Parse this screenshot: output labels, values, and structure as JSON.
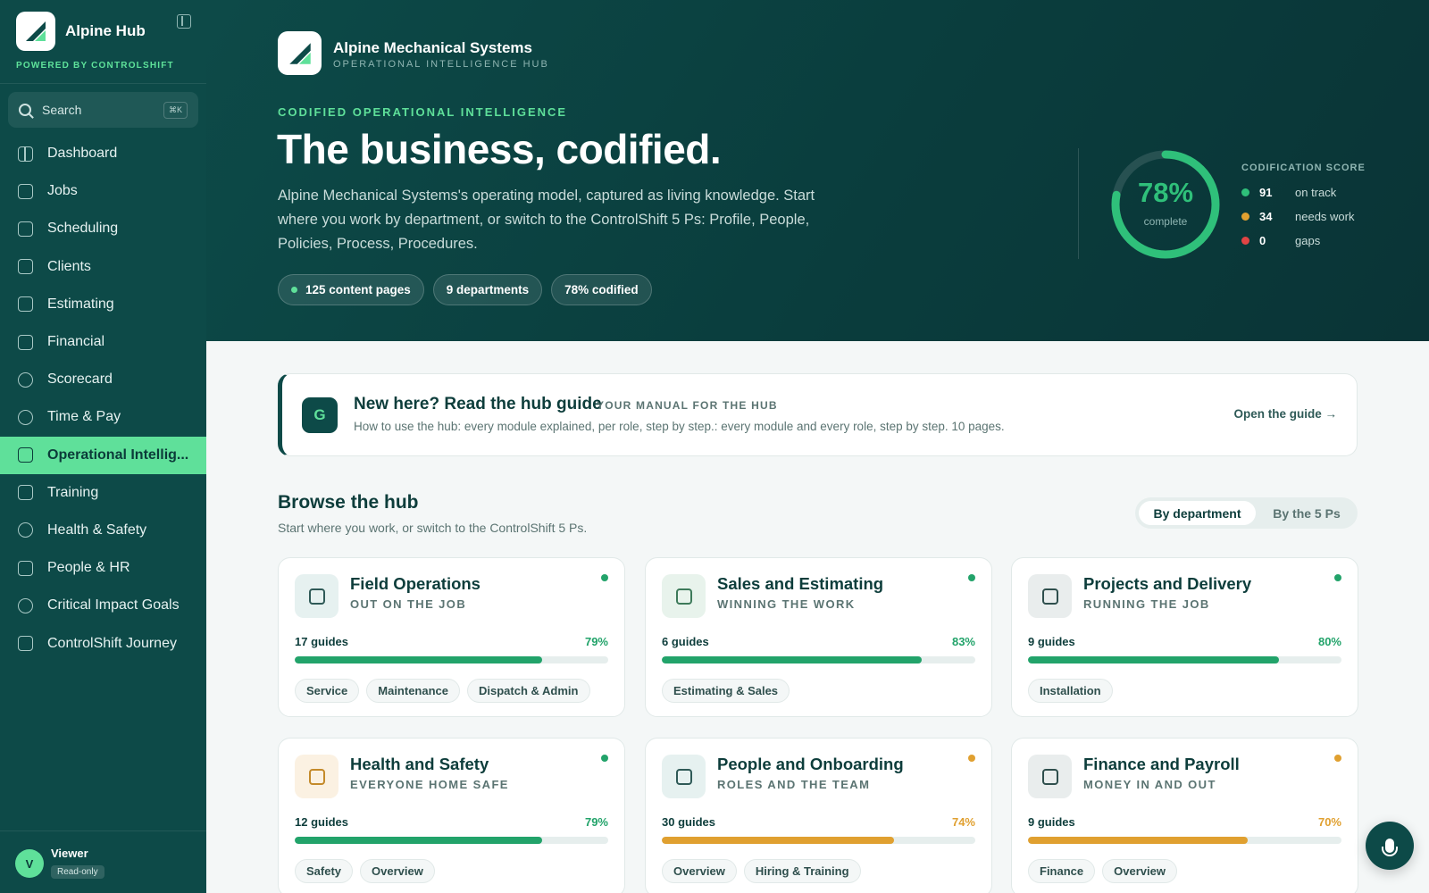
{
  "sidebar": {
    "brand": "Alpine Hub",
    "powered_by": "POWERED BY CONTROLSHIFT",
    "search_label": "Search",
    "search_shortcut": "⌘K",
    "items": [
      {
        "label": "Dashboard",
        "icon": "dashboard-icon"
      },
      {
        "label": "Jobs",
        "icon": "briefcase-icon"
      },
      {
        "label": "Scheduling",
        "icon": "calendar-icon"
      },
      {
        "label": "Clients",
        "icon": "clients-icon"
      },
      {
        "label": "Estimating",
        "icon": "calculator-icon"
      },
      {
        "label": "Financial",
        "icon": "credit-card-icon"
      },
      {
        "label": "Scorecard",
        "icon": "gauge-icon"
      },
      {
        "label": "Time & Pay",
        "icon": "clock-icon"
      },
      {
        "label": "Operational Intellig...",
        "icon": "book-icon"
      },
      {
        "label": "Training",
        "icon": "graduation-cap-icon"
      },
      {
        "label": "Health & Safety",
        "icon": "shield-icon"
      },
      {
        "label": "People & HR",
        "icon": "people-icon"
      },
      {
        "label": "Critical Impact Goals",
        "icon": "target-icon"
      },
      {
        "label": "ControlShift Journey",
        "icon": "route-icon"
      }
    ],
    "active_index": 8,
    "user": {
      "initial": "V",
      "name": "Viewer",
      "role": "Read-only"
    }
  },
  "hero": {
    "company": "Alpine Mechanical Systems",
    "company_sub": "OPERATIONAL INTELLIGENCE HUB",
    "eyebrow": "CODIFIED OPERATIONAL INTELLIGENCE",
    "headline": "The business, codified.",
    "lede": "Alpine Mechanical Systems's operating model, captured as living knowledge. Start where you work by department, or switch to the ControlShift 5 Ps: Profile, People, Policies, Process, Procedures.",
    "pills": [
      "125 content pages",
      "9 departments",
      "78%  codified"
    ],
    "score": {
      "title": "CODIFICATION SCORE",
      "percent_label": "78%",
      "percent": 78,
      "sub": "complete",
      "rows": [
        {
          "count": "91",
          "label": "on track",
          "color": "#2fc07a"
        },
        {
          "count": "34",
          "label": "needs work",
          "color": "#e0a030"
        },
        {
          "count": "0",
          "label": "gaps",
          "color": "#e04444"
        }
      ]
    }
  },
  "guide": {
    "badge": "G",
    "title": "New here? Read the hub guide",
    "tag": "YOUR MANUAL FOR THE HUB",
    "desc": "How to use the hub: every module explained, per role, step by step.: every module and every role, step by step. 10 pages.",
    "link": "Open the guide →"
  },
  "browse": {
    "title": "Browse the hub",
    "sub": "Start where you work, or switch to the ControlShift 5 Ps.",
    "toggle_on": "By department",
    "toggle_off": "By the 5 Ps"
  },
  "cards": [
    {
      "title": "Field Operations",
      "sub": "OUT ON THE JOB",
      "guides": "17 guides",
      "pct_label": "79%",
      "pct": 79,
      "status_color": "#22a36a",
      "icon": "hard-hat-icon",
      "icon_bg": "#e6f1f0",
      "icon_color": "#2f5a57",
      "tags": [
        "Service",
        "Maintenance",
        "Dispatch & Admin"
      ]
    },
    {
      "title": "Sales and Estimating",
      "sub": "WINNING THE WORK",
      "guides": "6 guides",
      "pct_label": "83%",
      "pct": 83,
      "status_color": "#22a36a",
      "icon": "calculator-icon",
      "icon_bg": "#e8f3ec",
      "icon_color": "#3d7a5a",
      "tags": [
        "Estimating & Sales"
      ]
    },
    {
      "title": "Projects and Delivery",
      "sub": "RUNNING THE JOB",
      "guides": "9 guides",
      "pct_label": "80%",
      "pct": 80,
      "status_color": "#22a36a",
      "icon": "board-icon",
      "icon_bg": "#e9eded",
      "icon_color": "#2f4f4d",
      "tags": [
        "Installation"
      ]
    },
    {
      "title": "Health and Safety",
      "sub": "EVERYONE HOME SAFE",
      "guides": "12 guides",
      "pct_label": "79%",
      "pct": 79,
      "status_color": "#22a36a",
      "icon": "shield-icon",
      "icon_bg": "#fbf1e2",
      "icon_color": "#c48a2a",
      "tags": [
        "Safety",
        "Overview"
      ]
    },
    {
      "title": "People and Onboarding",
      "sub": "ROLES AND THE TEAM",
      "guides": "30 guides",
      "pct_label": "74%",
      "pct": 74,
      "status_color": "#e0a030",
      "icon": "people-icon",
      "icon_bg": "#e6f1f0",
      "icon_color": "#2f5a57",
      "tags": [
        "Overview",
        "Hiring & Training"
      ]
    },
    {
      "title": "Finance and Payroll",
      "sub": "MONEY IN AND OUT",
      "guides": "9 guides",
      "pct_label": "70%",
      "pct": 70,
      "status_color": "#e0a030",
      "icon": "receipt-icon",
      "icon_bg": "#e9eded",
      "icon_color": "#2f4f4d",
      "tags": [
        "Finance",
        "Overview"
      ]
    }
  ],
  "colors": {
    "accent": "#5fe09a",
    "sidebar": "#0d4a48",
    "bar_green": "#22a36a",
    "bar_amber": "#e0a030"
  }
}
